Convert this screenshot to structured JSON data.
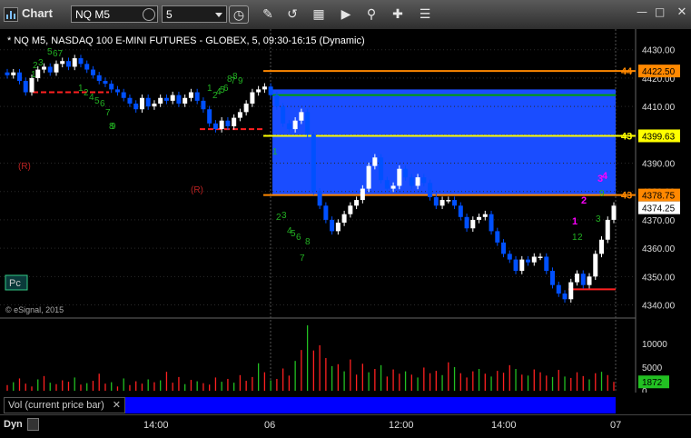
{
  "toolbar": {
    "title": "Chart",
    "symbol": "NQ M5",
    "interval": "5",
    "tools": [
      "clock-icon",
      "pencil-icon",
      "link-icon",
      "calendar-icon",
      "play-icon",
      "search-icon",
      "cross-icon",
      "news-icon"
    ]
  },
  "chart": {
    "header": "* NQ M5, NASDAQ 100 E-MINI FUTURES - GLOBEX, 5, 09:30-16:15 (Dynamic)",
    "copyright": "© eSignal, 2015",
    "pc_label": "Pc",
    "r_markers": [
      "(R)",
      "(R)"
    ],
    "price_axis": [
      "4430.00",
      "4420.00",
      "4410.00",
      "4400.00",
      "4390.00",
      "4380.00",
      "4370.00",
      "4360.00",
      "4350.00",
      "4340.00"
    ],
    "price_range": [
      4336,
      4436
    ],
    "tags": {
      "orange_top": "4422.50",
      "yellow": "4399.63",
      "orange_mid": "4378.75",
      "last": "4374.25"
    },
    "level_cut_labels": {
      "orange_top": "44",
      "yellow": "43",
      "orange_mid": "43"
    },
    "levels": {
      "blue_top": 4416,
      "green": 4414,
      "yellow": 4399.63,
      "orange_top": 4422.5,
      "orange_mid": 4378.75
    },
    "counts": {
      "green": [
        "1",
        "2",
        "3",
        "5",
        "67",
        "8",
        "1",
        "2",
        "4",
        "5",
        "6",
        "7",
        "8",
        "9",
        "8",
        "7",
        "9",
        "1",
        "2",
        "4",
        "5",
        "6",
        "1",
        "2",
        "3",
        "4",
        "5",
        "6",
        "7",
        "8",
        "1",
        "2",
        "3",
        "9"
      ],
      "magenta": [
        "1",
        "2",
        "3",
        "4"
      ]
    },
    "colors": {
      "up": "#ffffff",
      "down": "#0050ff",
      "zone": "#1a4dff",
      "orange": "#ff8800",
      "yellow": "#ffff00",
      "green": "#00a000",
      "red": "#ff2020",
      "count_green": "#22b022",
      "count_magenta": "#ff00ff"
    }
  },
  "chart_data": {
    "type": "candlestick",
    "ylim": [
      4336,
      4436
    ],
    "closes": [
      4421,
      4422,
      4419,
      4415,
      4420,
      4423,
      4424,
      4422,
      4425,
      4426,
      4424,
      4427,
      4425,
      4423,
      4421,
      4419,
      4418,
      4416,
      4415,
      4413,
      4411,
      4409,
      4413,
      4410,
      4411,
      4413,
      4412,
      4414,
      4411,
      4413,
      4415,
      4412,
      4409,
      4404,
      4402,
      4405,
      4403,
      4406,
      4408,
      4411,
      4415,
      4416,
      4417,
      4414,
      4410,
      4404,
      4402,
      4405,
      4408,
      4400,
      4380,
      4375,
      4370,
      4366,
      4369,
      4372,
      4375,
      4377,
      4381,
      4389,
      4392,
      4384,
      4381,
      4382,
      4388,
      4385,
      4382,
      4385,
      4383,
      4378,
      4375,
      4377,
      4377,
      4375,
      4371,
      4367,
      4370,
      4371,
      4372,
      4366,
      4362,
      4358,
      4356,
      4352,
      4356,
      4355,
      4357,
      4357,
      4352,
      4347,
      4344,
      4342,
      4348,
      4351,
      4347,
      4350,
      4358,
      4363,
      4370,
      4375
    ],
    "last": 4374.25
  },
  "volume": {
    "label": "Vol (current price bar)",
    "axis": [
      "10000",
      "5000",
      "0"
    ],
    "last": "1872",
    "bars": [
      1200,
      1800,
      2600,
      1500,
      900,
      2400,
      3100,
      1700,
      1400,
      2200,
      1900,
      2800,
      1300,
      1600,
      2100,
      3600,
      1500,
      1800,
      900,
      2600,
      1200,
      2000,
      1500,
      2400,
      1800,
      2200,
      4000,
      1700,
      2900,
      1400,
      2300,
      2000,
      1600,
      1300,
      2800,
      1900,
      2500,
      1700,
      3300,
      2100,
      2900,
      5800,
      3900,
      2200,
      2500,
      4700,
      3200,
      6300,
      8600,
      13800,
      8500,
      9600,
      6900,
      5200,
      5600,
      4100,
      6600,
      3400,
      5700,
      3900,
      4600,
      5400,
      3000,
      4500,
      3600,
      4100,
      3400,
      2800,
      4900,
      3700,
      4200,
      3300,
      6000,
      5000,
      3700,
      2800,
      4100,
      4600,
      3600,
      3000,
      4200,
      3800,
      5400,
      4600,
      3400,
      3200,
      4500,
      3900,
      3200,
      2900,
      4400,
      3000,
      2700,
      3900,
      3100,
      2400,
      3700,
      4000,
      3300,
      1872
    ]
  },
  "x_axis": [
    "14:00",
    "06",
    "12:00",
    "14:00",
    "07"
  ],
  "footer": {
    "dyn_label": "Dyn"
  }
}
